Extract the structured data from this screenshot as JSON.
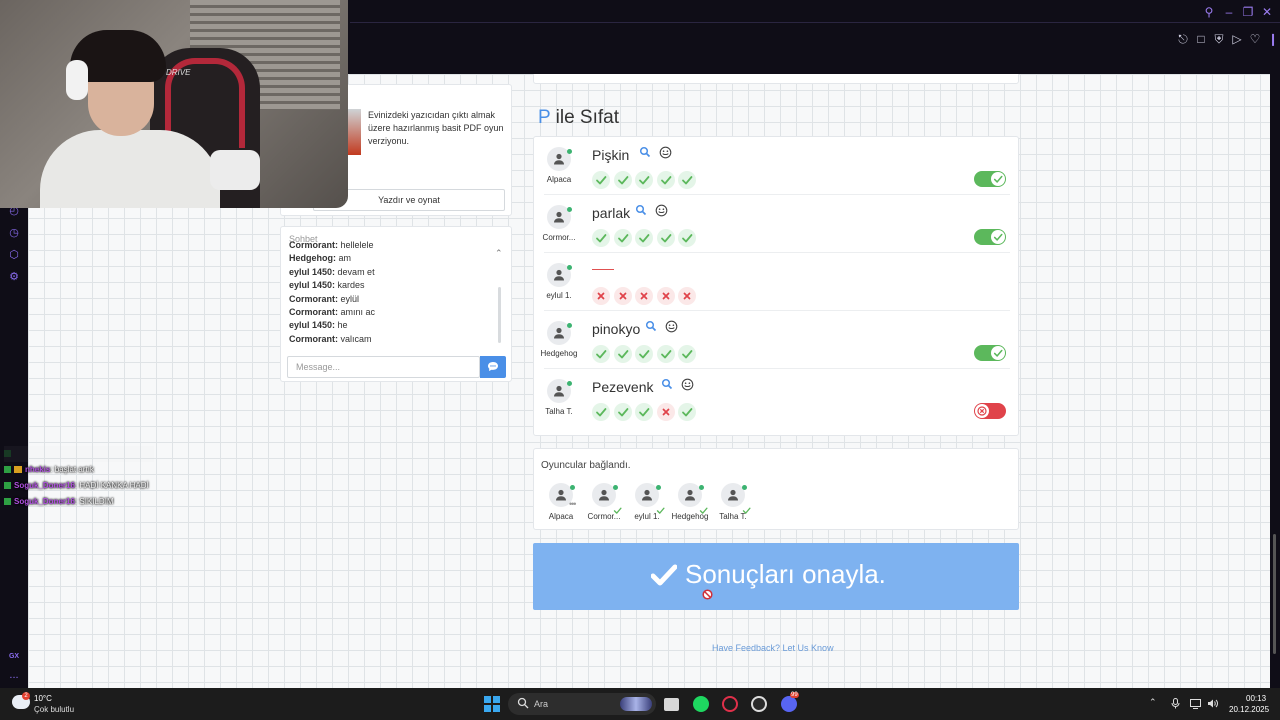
{
  "browser": {
    "window_controls": [
      "search-icon",
      "minimize-icon",
      "restore-icon",
      "close-icon"
    ],
    "toolbar_icons": [
      "pin-icon",
      "screenshot-icon",
      "shield-icon",
      "play-icon",
      "heart-icon"
    ],
    "sidebar_icons": [
      "history-icon",
      "clock-icon",
      "pinboard-icon",
      "settings-icon"
    ],
    "sidebar_gx_label": "GX",
    "sidebar_more_label": "...",
    "accent": "#9b7cf0"
  },
  "webcam": {
    "chair_brand": "DRIVE"
  },
  "print_card": {
    "description": "Evinizdeki yazıcıdan çıktı almak üzere hazırlanmış basit PDF oyun verziyonu.",
    "button_label": "Yazdır ve oynat"
  },
  "chat": {
    "title": "Sohbet",
    "messages": [
      {
        "user": "Cormorant:",
        "text": "hellelele"
      },
      {
        "user": "Hedgehog:",
        "text": "am"
      },
      {
        "user": "eylul 1450:",
        "text": "devam et"
      },
      {
        "user": "eylul 1450:",
        "text": "kardes"
      },
      {
        "user": "Cormorant:",
        "text": "eylül"
      },
      {
        "user": "Cormorant:",
        "text": "amını ac"
      },
      {
        "user": "eylul 1450:",
        "text": "he"
      },
      {
        "user": "Cormorant:",
        "text": "yalıcam"
      }
    ],
    "input_placeholder": "Message...",
    "send_icon": "chat-bubble-icon"
  },
  "round": {
    "letter": "P",
    "category": " ile Sıfat",
    "answers": [
      {
        "player": "Alpaca",
        "word": "Pişkin",
        "votes": [
          "ok",
          "ok",
          "ok",
          "ok",
          "ok"
        ],
        "approved": true,
        "has_word": true
      },
      {
        "player": "Cormor...",
        "word": "parlak",
        "votes": [
          "ok",
          "ok",
          "ok",
          "ok",
          "ok"
        ],
        "approved": true,
        "has_word": true
      },
      {
        "player": "eylul 1.",
        "word": "",
        "votes": [
          "no",
          "no",
          "no",
          "no",
          "no"
        ],
        "approved": null,
        "has_word": false
      },
      {
        "player": "Hedgehog",
        "word": "pinokyo",
        "votes": [
          "ok",
          "ok",
          "ok",
          "ok",
          "ok"
        ],
        "approved": true,
        "has_word": true
      },
      {
        "player": "Talha T.",
        "word": "Pezevenk",
        "votes": [
          "ok",
          "ok",
          "ok",
          "no",
          "ok"
        ],
        "approved": false,
        "has_word": true
      }
    ],
    "colors": {
      "ok": "#5cb85c",
      "no": "#e0434a",
      "accent": "#4a8fe7"
    }
  },
  "players": {
    "title": "Oyuncular bağlandı.",
    "list": [
      {
        "name": "Alpaca",
        "status": "typing"
      },
      {
        "name": "Cormor...",
        "status": "ready"
      },
      {
        "name": "eylul 1.",
        "status": "ready"
      },
      {
        "name": "Hedgehog",
        "status": "ready"
      },
      {
        "name": "Talha T.",
        "status": "ready"
      }
    ]
  },
  "confirm": {
    "label": "Sonuçları onayla."
  },
  "feedback": {
    "label": "Have Feedback? Let Us Know"
  },
  "overlay_chat": [
    {
      "user": "",
      "text": "",
      "faded": true
    },
    {
      "user": "nhekis",
      "text": ": başlat artık",
      "faded": false
    },
    {
      "user": "Soguk_Doner16",
      "text": ": HADİ KANKA HADİ",
      "faded": false
    },
    {
      "user": "Soguk_Doner16",
      "text": ": SIKILDIM",
      "faded": false
    }
  ],
  "taskbar": {
    "weather_temp": "10°C",
    "weather_desc": "Çok bulutlu",
    "weather_badge": "2",
    "search_label": "Ara",
    "apps": [
      "file-explorer-icon",
      "spotify-icon",
      "opera-gx-icon",
      "steam-icon",
      "discord-icon"
    ],
    "discord_badge": "99",
    "tray_icons": [
      "chevron-up-icon",
      "microphone-icon",
      "display-icon",
      "speaker-icon"
    ],
    "time": "00:13",
    "date": "20.12.2025"
  }
}
